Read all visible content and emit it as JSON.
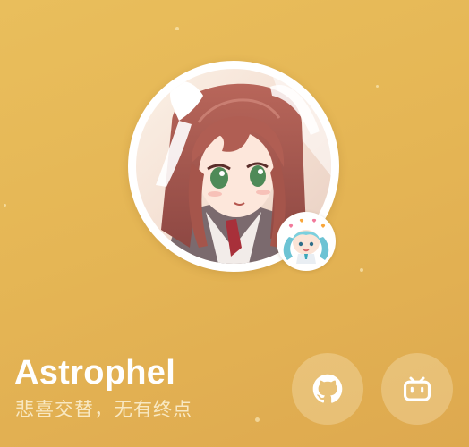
{
  "profile": {
    "name": "Astrophel",
    "motto": "悲喜交替，无有终点",
    "avatar": "anime-girl-portrait",
    "badge": "chibi-twin-tail-girl-sticker"
  },
  "social": [
    {
      "name": "github-icon"
    },
    {
      "name": "bilibili-icon"
    }
  ],
  "colors": {
    "background": "#e5b655",
    "name_text": "#ffffff",
    "motto_text": "#f8e8c2",
    "button_fill": "rgba(255,244,220,0.28)"
  }
}
